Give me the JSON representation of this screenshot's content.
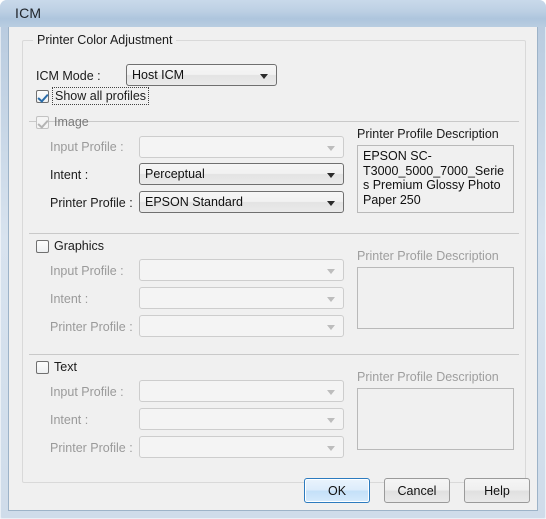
{
  "window": {
    "title": "ICM"
  },
  "groupbox": {
    "label": "Printer Color Adjustment"
  },
  "icm_mode": {
    "label": "ICM Mode :",
    "value": "Host ICM"
  },
  "show_all_profiles": {
    "label": "Show all profiles",
    "checked": true
  },
  "sections": [
    {
      "key": "image",
      "title": "Image",
      "checked": true,
      "disabled": true,
      "input_profile": {
        "label": "Input Profile :",
        "value": "",
        "disabled": true
      },
      "intent": {
        "label": "Intent :",
        "value": "Perceptual",
        "disabled": false
      },
      "printer_profile": {
        "label": "Printer Profile :",
        "value": "EPSON Standard",
        "disabled": false
      },
      "description": {
        "label": "Printer Profile Description",
        "text": "EPSON SC-T3000_5000_7000_Series Premium Glossy Photo Paper 250",
        "disabled": false
      }
    },
    {
      "key": "graphics",
      "title": "Graphics",
      "checked": false,
      "disabled": false,
      "input_profile": {
        "label": "Input Profile :",
        "value": "",
        "disabled": true
      },
      "intent": {
        "label": "Intent :",
        "value": "",
        "disabled": true
      },
      "printer_profile": {
        "label": "Printer Profile :",
        "value": "",
        "disabled": true
      },
      "description": {
        "label": "Printer Profile Description",
        "text": "",
        "disabled": true
      }
    },
    {
      "key": "text",
      "title": "Text",
      "checked": false,
      "disabled": false,
      "input_profile": {
        "label": "Input Profile :",
        "value": "",
        "disabled": true
      },
      "intent": {
        "label": "Intent :",
        "value": "",
        "disabled": true
      },
      "printer_profile": {
        "label": "Printer Profile :",
        "value": "",
        "disabled": true
      },
      "description": {
        "label": "Printer Profile Description",
        "text": "",
        "disabled": true
      }
    }
  ],
  "buttons": {
    "ok": "OK",
    "cancel": "Cancel",
    "help": "Help"
  },
  "colors": {
    "accent": "#2c7bbf",
    "titlebar": "#b6c9de",
    "client_bg": "#f0f0f0",
    "check": "#2a6ca8"
  }
}
